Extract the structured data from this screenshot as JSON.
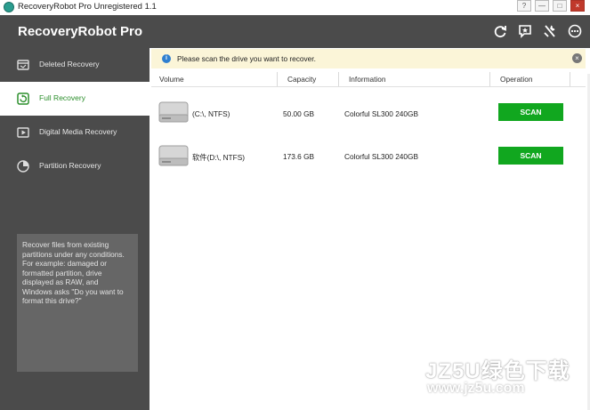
{
  "window": {
    "title": "RecoveryRobot Pro Unregistered 1.1",
    "controls": [
      "?",
      "—",
      "□",
      "×"
    ]
  },
  "header": {
    "app_name": "RecoveryRobot Pro",
    "icons": [
      "refresh-icon",
      "feedback-icon",
      "tools-icon",
      "more-icon"
    ]
  },
  "sidebar": {
    "items": [
      {
        "label": "Deleted Recovery",
        "icon": "deleted-recovery-icon",
        "active": false
      },
      {
        "label": "Full Recovery",
        "icon": "full-recovery-icon",
        "active": true
      },
      {
        "label": "Digital Media Recovery",
        "icon": "media-icon",
        "active": false
      },
      {
        "label": "Partition Recovery",
        "icon": "partition-icon",
        "active": false
      }
    ],
    "info_lines": [
      "Recover files from existing",
      "partitions under any conditions.",
      "For example: damaged or",
      "formatted partition, drive",
      "displayed as RAW, and",
      "Windows asks \"Do you want to",
      "format this drive?\""
    ]
  },
  "notice": {
    "text": "Please scan the drive you want to recover."
  },
  "table": {
    "headers": [
      "Volume",
      "Capacity",
      "Information",
      "Operation"
    ],
    "rows": [
      {
        "volume": "(C:\\, NTFS)",
        "capacity": "50.00 GB",
        "information": "Colorful SL300 240GB",
        "action": "SCAN"
      },
      {
        "volume": "软件(D:\\, NTFS)",
        "capacity": "173.6 GB",
        "information": "Colorful SL300 240GB",
        "action": "SCAN"
      }
    ]
  },
  "watermark": {
    "main": "JZ5U绿色下载",
    "sub": "www.jz5u.com"
  },
  "colors": {
    "header_bg": "#4b4b4b",
    "accent_green": "#11a71f",
    "notice_bg": "#fbf5d8",
    "info_blue": "#2f7fd0"
  }
}
